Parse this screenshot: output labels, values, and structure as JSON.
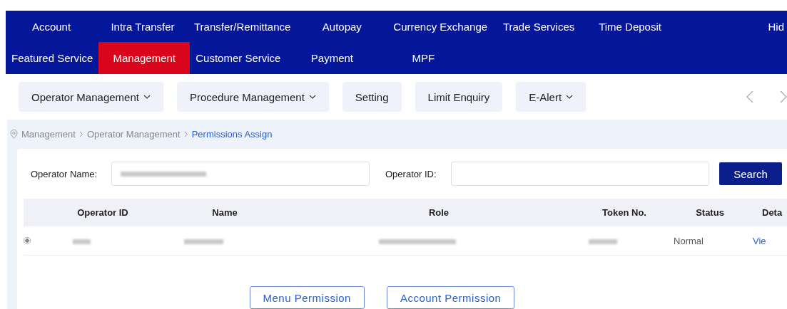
{
  "main_nav": {
    "rows": [
      [
        {
          "label": "Account",
          "selected": false
        },
        {
          "label": "Intra Transfer",
          "selected": false
        },
        {
          "label": "Transfer/Remittance",
          "selected": false
        },
        {
          "label": "Autopay",
          "selected": false
        },
        {
          "label": "Currency Exchange",
          "selected": false
        },
        {
          "label": "Trade Services",
          "selected": false
        },
        {
          "label": "Time Deposit",
          "selected": false
        }
      ],
      [
        {
          "label": "Featured Service",
          "selected": false
        },
        {
          "label": "Management",
          "selected": true
        },
        {
          "label": "Customer Service",
          "selected": false
        },
        {
          "label": "Payment",
          "selected": false
        },
        {
          "label": "MPF",
          "selected": false
        }
      ]
    ],
    "hide_label": "Hid"
  },
  "sub_nav": [
    {
      "label": "Operator Management",
      "dropdown": true
    },
    {
      "label": "Procedure Management",
      "dropdown": true
    },
    {
      "label": "Setting",
      "dropdown": false
    },
    {
      "label": "Limit Enquiry",
      "dropdown": false
    },
    {
      "label": "E-Alert",
      "dropdown": true
    }
  ],
  "breadcrumb": [
    {
      "label": "Management",
      "current": false
    },
    {
      "label": "Operator Management",
      "current": false
    },
    {
      "label": "Permissions Assign",
      "current": true
    }
  ],
  "search_form": {
    "fields": [
      {
        "label": "Operator Name:",
        "value_redacted": true
      },
      {
        "label": "Operator ID:",
        "value_redacted": false
      }
    ],
    "button": "Search"
  },
  "table": {
    "columns": [
      "Operator ID",
      "Name",
      "Role",
      "Token No.",
      "Status",
      "Deta"
    ],
    "rows": [
      {
        "selected": true,
        "cells": [
          {
            "kind": "redacted"
          },
          {
            "kind": "redacted"
          },
          {
            "kind": "redacted"
          },
          {
            "kind": "redacted"
          },
          {
            "kind": "text",
            "text": "Normal"
          },
          {
            "kind": "link",
            "text": "Vie"
          }
        ]
      }
    ]
  },
  "actions": [
    "Menu Permission",
    "Account Permission"
  ]
}
